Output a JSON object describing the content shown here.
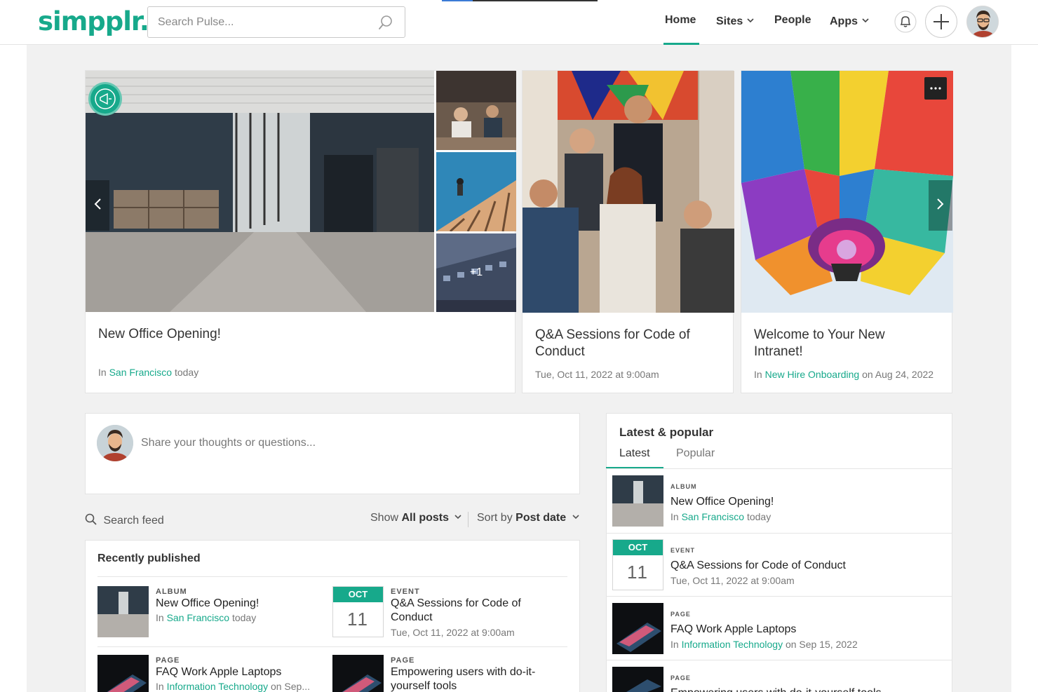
{
  "header": {
    "logo": "simpplr.",
    "search_placeholder": "Search Pulse...",
    "nav": [
      {
        "label": "Home"
      },
      {
        "label": "Sites"
      },
      {
        "label": "People"
      },
      {
        "label": "Apps"
      }
    ]
  },
  "featured": [
    {
      "title": "New Office Opening!",
      "meta_prefix": "In ",
      "meta_link": "San Francisco",
      "meta_suffix": " today",
      "more_count": "+1"
    },
    {
      "title": "Q&A Sessions for Code of Conduct",
      "meta": "Tue, Oct 11, 2022 at 9:00am"
    },
    {
      "title": "Welcome to Your New Intranet!",
      "meta_prefix": "In ",
      "meta_link": "New Hire Onboarding",
      "meta_suffix": " on Aug 24, 2022"
    }
  ],
  "share": {
    "placeholder": "Share your thoughts or questions..."
  },
  "feed": {
    "search_label": "Search feed",
    "show_prefix": "Show ",
    "show_value": "All posts",
    "sort_prefix": "Sort by ",
    "sort_value": "Post date"
  },
  "recently_published": {
    "title": "Recently published",
    "items": [
      {
        "type": "Album",
        "title": "New Office Opening!",
        "meta_prefix": "In ",
        "meta_link": "San Francisco",
        "meta_suffix": " today"
      },
      {
        "type": "Event",
        "title": "Q&A Sessions for Code of Conduct",
        "meta": "Tue, Oct 11, 2022 at 9:00am",
        "month": "OCT",
        "day": "11"
      },
      {
        "type": "Page",
        "title": "FAQ Work Apple Laptops",
        "meta_prefix": "In ",
        "meta_link": "Information Technology",
        "meta_suffix": " on Sep..."
      },
      {
        "type": "Page",
        "title": "Empowering users with do-it-yourself tools"
      }
    ]
  },
  "latest_popular": {
    "title": "Latest & popular",
    "tabs": [
      {
        "label": "Latest"
      },
      {
        "label": "Popular"
      }
    ],
    "items": [
      {
        "type": "Album",
        "title": "New Office Opening!",
        "meta_prefix": "In ",
        "meta_link": "San Francisco",
        "meta_suffix": " today"
      },
      {
        "type": "Event",
        "title": "Q&A Sessions for Code of Conduct",
        "meta": "Tue, Oct 11, 2022 at 9:00am",
        "month": "OCT",
        "day": "11"
      },
      {
        "type": "Page",
        "title": "FAQ Work Apple Laptops",
        "meta_prefix": "In ",
        "meta_link": "Information Technology",
        "meta_suffix": " on Sep 15, 2022"
      },
      {
        "type": "Page",
        "title": "Empowering users with do-it-yourself tools"
      }
    ]
  },
  "colors": {
    "brand": "#17a98b",
    "text": "#333333",
    "background": "#f1f1f1"
  }
}
